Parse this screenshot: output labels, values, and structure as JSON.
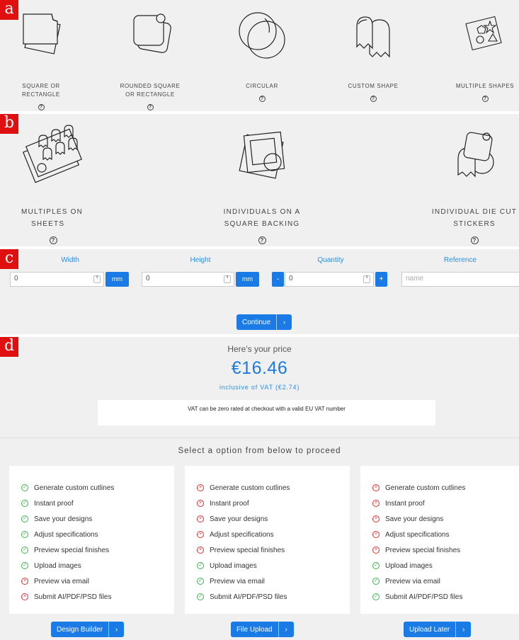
{
  "badges": {
    "a": "a",
    "b": "b",
    "c": "c",
    "d": "d"
  },
  "help_glyph": "?",
  "shapes": [
    {
      "label_line1": "SQUARE OR",
      "label_line2": "RECTANGLE"
    },
    {
      "label_line1": "ROUNDED SQUARE",
      "label_line2": "OR RECTANGLE"
    },
    {
      "label_line1": "CIRCULAR",
      "label_line2": ""
    },
    {
      "label_line1": "CUSTOM SHAPE",
      "label_line2": ""
    },
    {
      "label_line1": "MULTIPLE SHAPES",
      "label_line2": ""
    }
  ],
  "formats": [
    {
      "label_line1": "MULTIPLES ON",
      "label_line2": "SHEETS"
    },
    {
      "label_line1": "INDIVIDUALS ON A",
      "label_line2": "SQUARE BACKING"
    },
    {
      "label_line1": "INDIVIDUAL DIE CUT",
      "label_line2": "STICKERS"
    }
  ],
  "dimensions": {
    "width_label": "Width",
    "height_label": "Height",
    "quantity_label": "Quantity",
    "reference_label": "Reference",
    "width_value": "0",
    "height_value": "0",
    "quantity_value": "0",
    "reference_placeholder": "name",
    "unit": "mm",
    "minus": "-",
    "plus": "+",
    "spinner_glyph": "⬍",
    "continue_label": "Continue",
    "arrow": "›"
  },
  "price": {
    "heading": "Here's your price",
    "amount": "€16.46",
    "vat_line": "inclusive of VAT (€2.74)",
    "vat_note": "VAT can be zero rated at checkout with a valid EU VAT number",
    "select_heading": "Select a option from below to proceed"
  },
  "icons": {
    "yes": "✓",
    "no": "×"
  },
  "options": [
    {
      "button": "Design Builder",
      "features": [
        {
          "text": "Generate custom cutlines",
          "ok": true
        },
        {
          "text": "Instant proof",
          "ok": true
        },
        {
          "text": "Save your designs",
          "ok": true
        },
        {
          "text": "Adjust specifications",
          "ok": true
        },
        {
          "text": "Preview special finishes",
          "ok": true
        },
        {
          "text": "Upload images",
          "ok": true
        },
        {
          "text": "Preview via email",
          "ok": false
        },
        {
          "text": "Submit AI/PDF/PSD files",
          "ok": false
        }
      ]
    },
    {
      "button": "File Upload",
      "features": [
        {
          "text": "Generate custom cutlines",
          "ok": false
        },
        {
          "text": "Instant proof",
          "ok": false
        },
        {
          "text": "Save your designs",
          "ok": false
        },
        {
          "text": "Adjust specifications",
          "ok": false
        },
        {
          "text": "Preview special finishes",
          "ok": false
        },
        {
          "text": "Upload images",
          "ok": true
        },
        {
          "text": "Preview via email",
          "ok": true
        },
        {
          "text": "Submit AI/PDF/PSD files",
          "ok": true
        }
      ]
    },
    {
      "button": "Upload Later",
      "features": [
        {
          "text": "Generate custom cutlines",
          "ok": false
        },
        {
          "text": "Instant proof",
          "ok": false
        },
        {
          "text": "Save your designs",
          "ok": false
        },
        {
          "text": "Adjust specifications",
          "ok": false
        },
        {
          "text": "Preview special finishes",
          "ok": false
        },
        {
          "text": "Upload images",
          "ok": true
        },
        {
          "text": "Preview via email",
          "ok": true
        },
        {
          "text": "Submit AI/PDF/PSD files",
          "ok": true
        }
      ]
    }
  ],
  "colors": {
    "accent": "#1a7be6",
    "yes": "#3bb54a",
    "no": "#e03030",
    "badge": "#e01010",
    "panel": "#f0f0f0"
  }
}
